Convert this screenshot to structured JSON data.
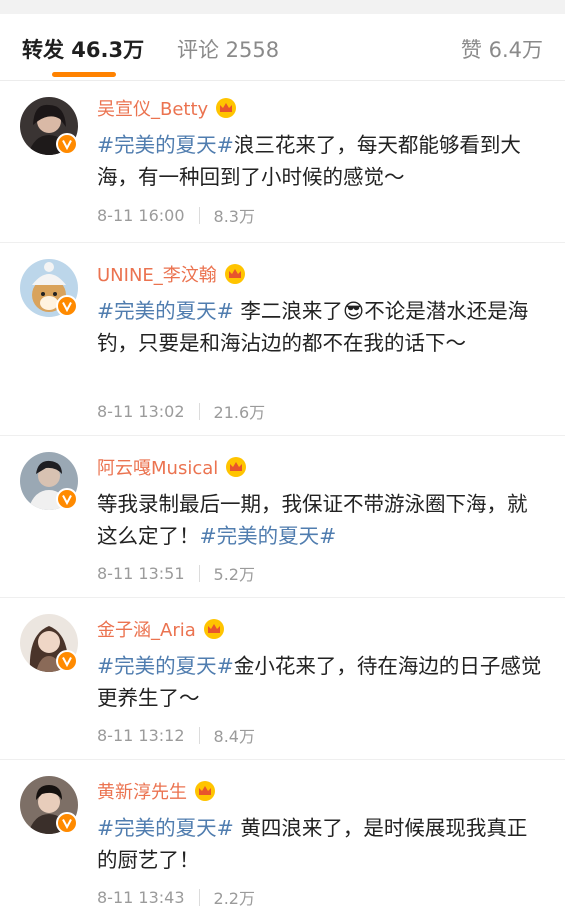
{
  "tabs": {
    "repost": "转发 46.3万",
    "comment": "评论 2558",
    "like": "赞 6.4万"
  },
  "accent_color": "#ff8200",
  "items": [
    {
      "name": "吴宣仪_Betty",
      "tag": "#完美的夏天#",
      "text": "浪三花来了，每天都能够看到大海，有一种回到了小时候的感觉～",
      "time": "8-11 16:00",
      "count": "8.3万"
    },
    {
      "name": "UNINE_李汶翰",
      "tag": "#完美的夏天#",
      "text": " 李二浪来了😎不论是潜水还是海钓，只要是和海沾边的都不在我的话下～",
      "time": "8-11 13:02",
      "count": "21.6万"
    },
    {
      "name": "阿云嘎Musical",
      "text": "等我录制最后一期，我保证不带游泳圈下海，就这么定了！",
      "tag": "#完美的夏天#",
      "time": "8-11 13:51",
      "count": "5.2万"
    },
    {
      "name": "金子涵_Aria",
      "tag": "#完美的夏天#",
      "text": "金小花来了，待在海边的日子感觉更养生了～",
      "time": "8-11 13:12",
      "count": "8.4万"
    },
    {
      "name": "黄新淳先生",
      "tag": "#完美的夏天#",
      "text": " 黄四浪来了，是时候展现我真正的厨艺了！",
      "time": "8-11 13:43",
      "count": "2.2万"
    }
  ]
}
